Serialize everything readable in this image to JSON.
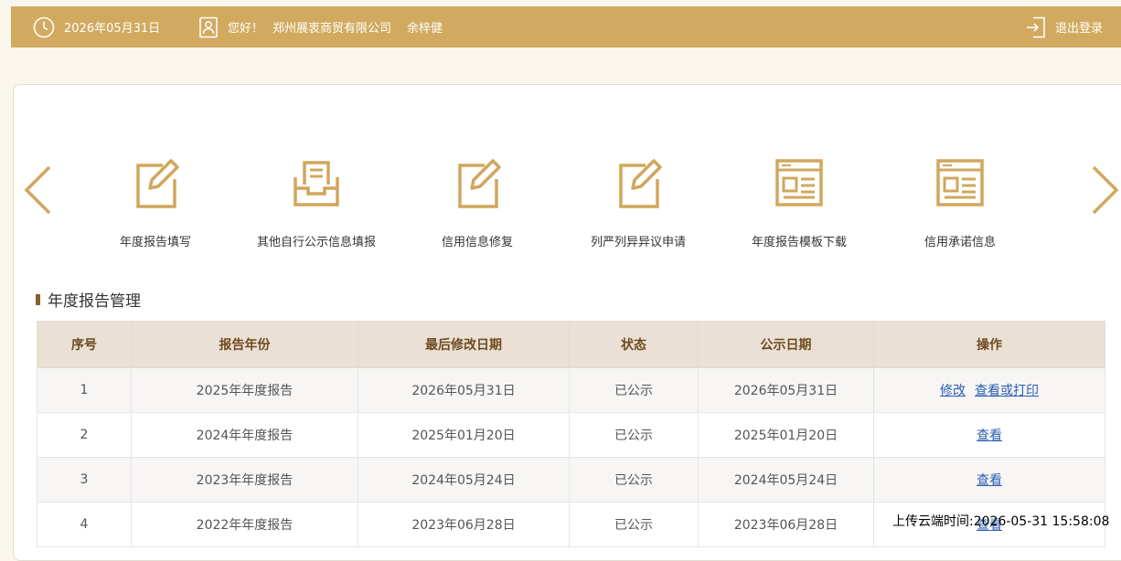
{
  "header": {
    "date": "2026年05月31日",
    "greeting": "您好！",
    "company": "郑州展衷商贸有限公司",
    "username": "余梓健",
    "logout_label": "退出登录"
  },
  "functions": [
    {
      "label": "年度报告填写",
      "icon": "edit-icon"
    },
    {
      "label": "其他自行公示信息填报",
      "icon": "inbox-document-icon"
    },
    {
      "label": "信用信息修复",
      "icon": "edit-icon"
    },
    {
      "label": "列严列异异议申请",
      "icon": "edit-icon"
    },
    {
      "label": "年度报告模板下载",
      "icon": "template-window-icon"
    },
    {
      "label": "信用承诺信息",
      "icon": "template-window-icon"
    }
  ],
  "section_title": "年度报告管理",
  "table": {
    "headers": [
      "序号",
      "报告年份",
      "最后修改日期",
      "状态",
      "公示日期",
      "操作"
    ],
    "rows": [
      {
        "no": "1",
        "year": "2025年年度报告",
        "modified": "2026年05月31日",
        "status": "已公示",
        "publish": "2026年05月31日",
        "actions": [
          "修改",
          "查看或打印"
        ]
      },
      {
        "no": "2",
        "year": "2024年年度报告",
        "modified": "2025年01月20日",
        "status": "已公示",
        "publish": "2025年01月20日",
        "actions": [
          "查看"
        ]
      },
      {
        "no": "3",
        "year": "2023年年度报告",
        "modified": "2024年05月24日",
        "status": "已公示",
        "publish": "2024年05月24日",
        "actions": [
          "查看"
        ]
      },
      {
        "no": "4",
        "year": "2022年年度报告",
        "modified": "2023年06月28日",
        "status": "已公示",
        "publish": "2023年06月28日",
        "actions": [
          "查看"
        ]
      }
    ]
  },
  "upload_stamp": "上传云端时间:2026-05-31 15:58:08",
  "colors": {
    "accent": "#d2aa5f",
    "icon": "#d0a75c",
    "link": "#2a5cb3",
    "header_bg": "#eae0d5"
  }
}
